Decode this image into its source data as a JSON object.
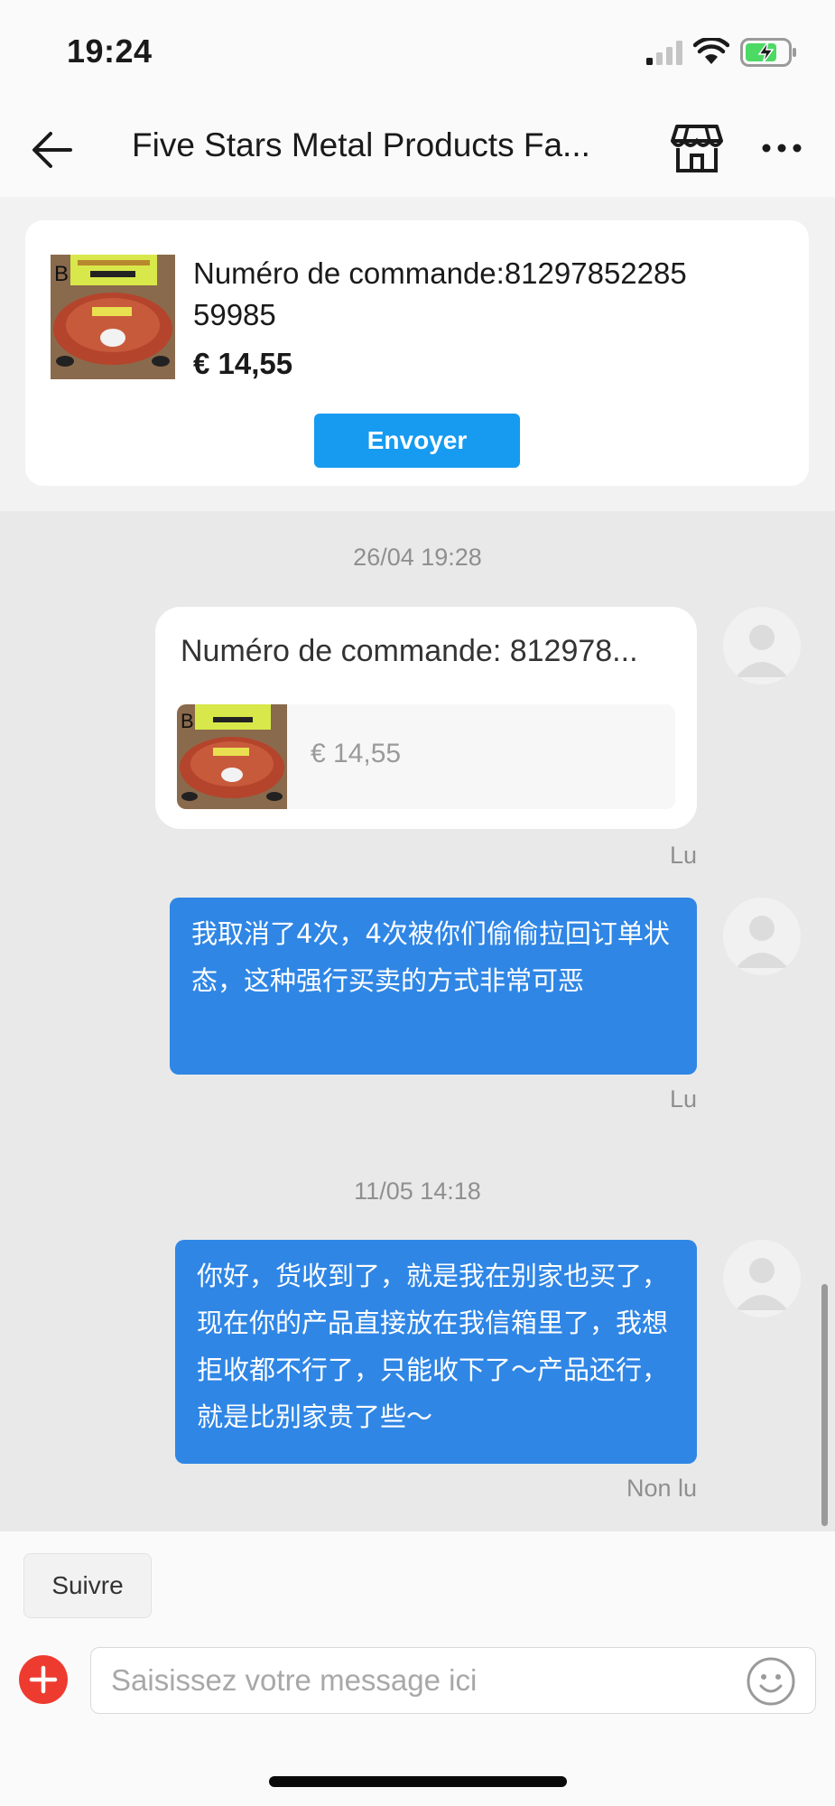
{
  "status_bar": {
    "time": "19:24",
    "icons": [
      "cellular-signal-icon",
      "wifi-icon",
      "battery-charging-icon"
    ]
  },
  "header": {
    "title": "Five Stars Metal Products Fa...",
    "icons": [
      "back-arrow-icon",
      "shop-icon",
      "more-icon"
    ]
  },
  "order_card": {
    "thumb_label": "B",
    "order_number_label": "Numéro de commande:8129785228559985",
    "price": "€ 14,55",
    "send_label": "Envoyer"
  },
  "messages": [
    {
      "timestamp": "26/04 19:28",
      "type": "order",
      "title": "Numéro de commande: 812978...",
      "thumb_label": "B",
      "price": "€ 14,55",
      "status": "Lu"
    },
    {
      "type": "text",
      "text": "我取消了4次，4次被你们偷偷拉回订单状态，这种强行买卖的方式非常可恶",
      "status": "Lu"
    },
    {
      "timestamp": "11/05 14:18",
      "type": "text",
      "text": "你好，货收到了，就是我在别家也买了，现在你的产品直接放在我信箱里了，我想拒收都不行了，只能收下了～产品还行，就是比别家贵了些～",
      "status": "Non lu"
    }
  ],
  "composer": {
    "follow_label": "Suivre",
    "placeholder": "Saisissez votre message ici",
    "icons": [
      "add-icon",
      "emoji-icon"
    ]
  },
  "colors": {
    "accent_blue": "#169bf0",
    "bubble_blue": "#2f86e5",
    "add_red": "#ee3b2f",
    "chat_background": "#e9e9e9"
  }
}
